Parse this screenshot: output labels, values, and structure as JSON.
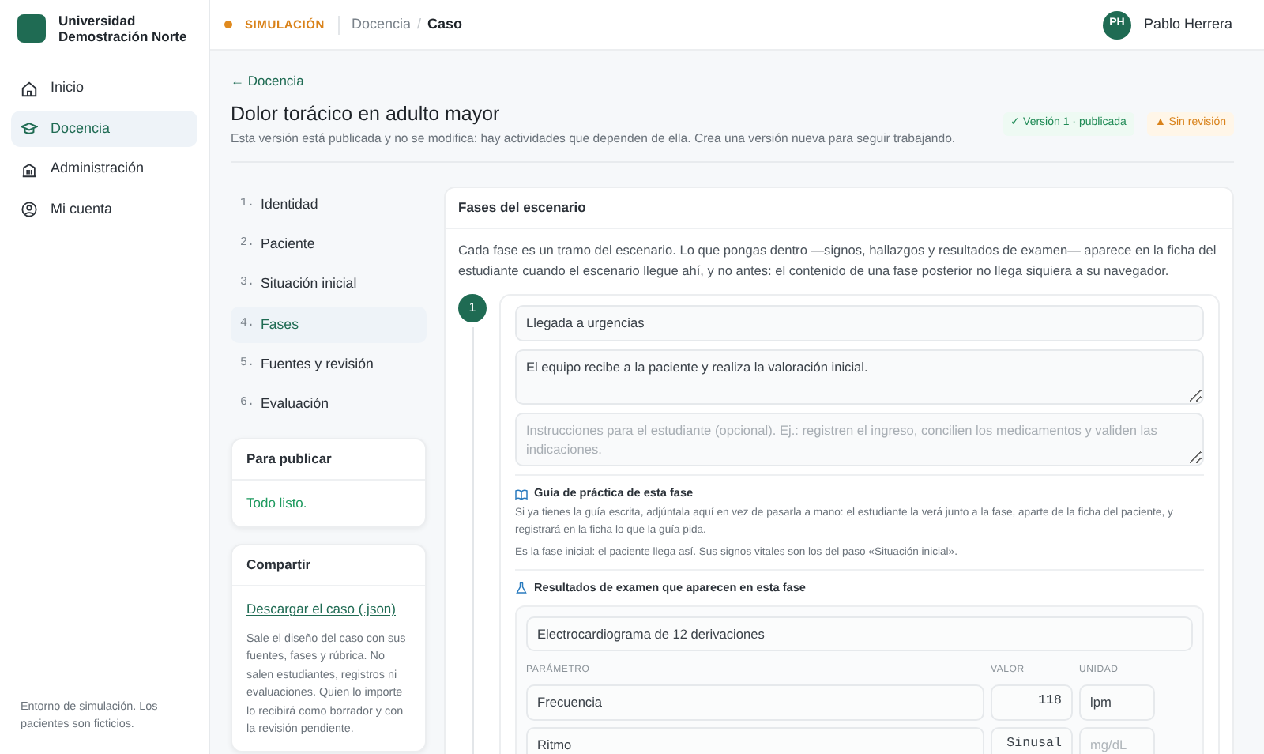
{
  "brand": {
    "name": "Universidad Demostración Norte"
  },
  "sidebar": {
    "items": [
      {
        "label": "Inicio",
        "kind": "home",
        "selected": false
      },
      {
        "label": "Docencia",
        "kind": "teaching",
        "selected": true
      },
      {
        "label": "Administración",
        "kind": "admin",
        "selected": false
      },
      {
        "label": "Mi cuenta",
        "kind": "account",
        "selected": false
      }
    ],
    "footer": "Entorno de simulación. Los pacientes son ficticios."
  },
  "topbar": {
    "mode": "SIMULACIÓN",
    "breadcrumb": [
      "Docencia",
      "Caso"
    ],
    "breadcrumb_separator": "/",
    "user": {
      "initials": "PH",
      "name": "Pablo Herrera"
    }
  },
  "page": {
    "back_link": "← Docencia",
    "title": "Dolor torácico en adulto mayor",
    "subtitle": "Esta versión está publicada y no se modifica: hay actividades que dependen de ella. Crea una versión nueva para seguir trabajando.",
    "badges": [
      {
        "kind": "success",
        "text": "✓ Versión 1 · publicada"
      },
      {
        "kind": "warning",
        "text": "▲ Sin revisión"
      }
    ]
  },
  "steps": [
    {
      "number": "1.",
      "label": "Identidad",
      "selected": false
    },
    {
      "number": "2.",
      "label": "Paciente",
      "selected": false
    },
    {
      "number": "3.",
      "label": "Situación inicial",
      "selected": false
    },
    {
      "number": "4.",
      "label": "Fases",
      "selected": true
    },
    {
      "number": "5.",
      "label": "Fuentes y revisión",
      "selected": false
    },
    {
      "number": "6.",
      "label": "Evaluación",
      "selected": false
    }
  ],
  "publish_card": {
    "title": "Para publicar",
    "status": "Todo listo."
  },
  "share_card": {
    "title": "Compartir",
    "link": "Descargar el caso (.json)",
    "text": "Sale el diseño del caso con sus fuentes, fases y rúbrica. No salen estudiantes, registros ni evaluaciones. Quien lo importe lo recibirá como borrador y con la revisión pendiente."
  },
  "phases_card": {
    "title": "Fases del escenario",
    "intro": "Cada fase es un tramo del escenario. Lo que pongas dentro —signos, hallazgos y resultados de examen— aparece en la ficha del estudiante cuando el escenario llegue ahí, y no antes: el contenido de una fase posterior no llega siquiera a su navegador.",
    "phases": [
      {
        "number": "1",
        "name": "Llegada a urgencias",
        "description": "El equipo recibe a la paciente y realiza la valoración inicial.",
        "instructions_placeholder": "Instrucciones para el estudiante (opcional). Ej.: registren el ingreso, concilien los medicamentos y validen las indicaciones.",
        "guide": {
          "title": "Guía de práctica de esta fase",
          "text": "Si ya tienes la guía escrita, adjúntala aquí en vez de pasarla a mano: el estudiante la verá junto a la fase, aparte de la ficha del paciente, y registrará en la ficha lo que la guía pida.",
          "note": "Es la fase inicial: el paciente llega así. Sus signos vitales son los del paso «Situación inicial»."
        },
        "exams": {
          "title": "Resultados de examen que aparecen en esta fase",
          "columns": [
            "PARÁMETRO",
            "VALOR",
            "UNIDAD"
          ],
          "items": [
            {
              "name": "Electrocardiograma de 12 derivaciones",
              "rows": [
                {
                  "parameter": "Frecuencia",
                  "value": "118",
                  "unit": "lpm"
                },
                {
                  "parameter": "Ritmo",
                  "value": "Sinusal",
                  "unit_placeholder": "mg/dL"
                }
              ]
            }
          ]
        }
      }
    ]
  }
}
